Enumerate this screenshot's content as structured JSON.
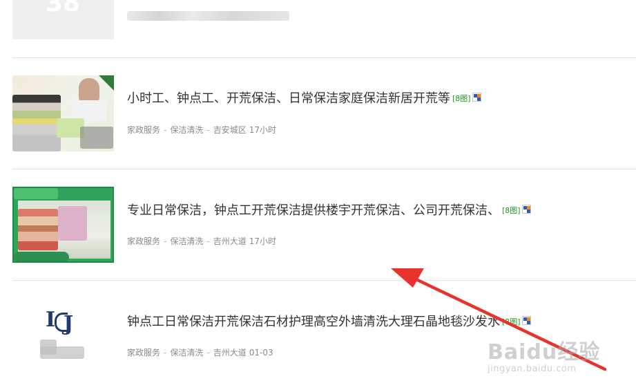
{
  "listings": [
    {
      "title": "小时工、钟点工、开荒保洁、日常保洁家庭保洁新居开荒等",
      "image_count": "[8图]",
      "category": "家政服务",
      "subcategory": "保洁清洗",
      "location": "吉安城区",
      "time": "17小时"
    },
    {
      "title": "专业日常保洁，钟点工开荒保洁提供楼宇开荒保洁、公司开荒保洁、",
      "image_count": "[8图]",
      "category": "家政服务",
      "subcategory": "保洁清洗",
      "location": "吉州大道",
      "time": "17小时"
    },
    {
      "title": "钟点工日常保洁开荒保洁石材护理高空外墙清洗大理石晶地毯沙发水",
      "image_count": "[8图]",
      "category": "家政服务",
      "subcategory": "保洁清洗",
      "location": "吉州大道",
      "time": "01-03"
    }
  ],
  "meta_separator": "-",
  "watermark": {
    "brand": "Baidu经验",
    "site": "jingyan.baidu.com"
  },
  "icons": {
    "shop": "shop-badge-icon",
    "arrow": "red-annotation-arrow"
  },
  "colors": {
    "image_count": "#1d9a1d",
    "arrow": "#e8322e",
    "title": "#333333",
    "meta": "#8a8a8a"
  }
}
